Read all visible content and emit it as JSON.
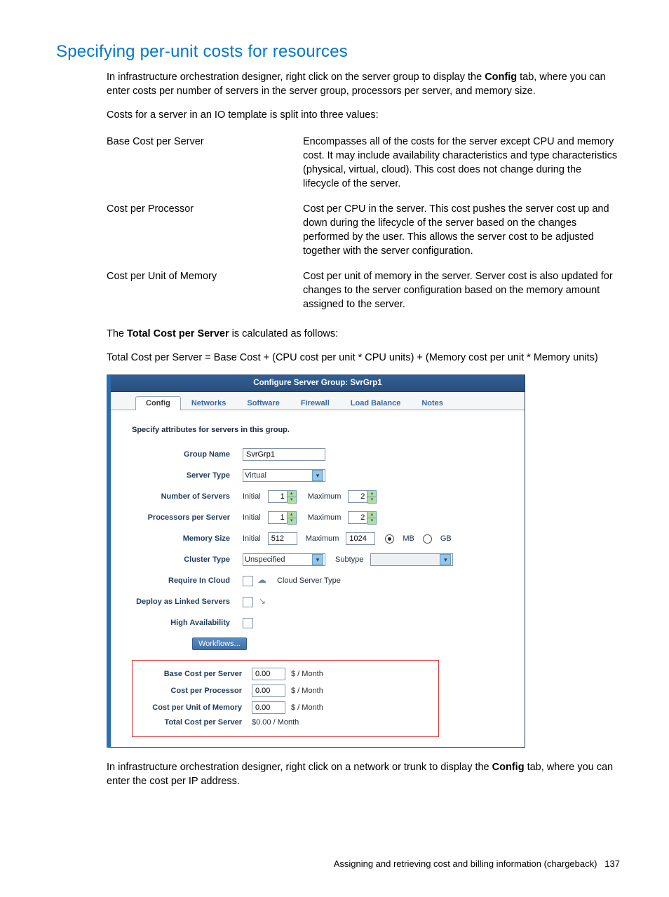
{
  "heading": "Specifying per-unit costs for resources",
  "p1_a": "In infrastructure orchestration designer, right click on the server group to display the ",
  "p1_b": "Config",
  "p1_c": " tab, where you can enter costs per number of servers in the server group, processors per server, and memory size.",
  "p2": "Costs for a server in an IO template is split into three values:",
  "defs": [
    {
      "term": "Base Cost per Server",
      "desc": "Encompasses all of the costs for the server except CPU and memory cost. It may include availability characteristics and type characteristics (physical, virtual, cloud). This cost does not change during the lifecycle of the server."
    },
    {
      "term": "Cost per Processor",
      "desc": "Cost per CPU in the server. This cost pushes the server cost up and down during the lifecycle of the server based on the changes performed by the user. This allows the server cost to be adjusted together with the server configuration."
    },
    {
      "term": "Cost per Unit of Memory",
      "desc": "Cost per unit of memory in the server. Server cost is also updated for changes to the server configuration based on the memory amount assigned to the server."
    }
  ],
  "p3_a": "The ",
  "p3_b": "Total Cost per Server",
  "p3_c": " is calculated as follows:",
  "formula": "Total Cost per Server = Base Cost + (CPU cost per unit * CPU units) + (Memory cost per unit * Memory units)",
  "dialog": {
    "title": "Configure Server Group: SvrGrp1",
    "tabs": [
      "Config",
      "Networks",
      "Software",
      "Firewall",
      "Load Balance",
      "Notes"
    ],
    "specify": "Specify attributes for servers in this group.",
    "group_name_label": "Group Name",
    "group_name": "SvrGrp1",
    "server_type_label": "Server Type",
    "server_type": "Virtual",
    "num_servers_label": "Number of Servers",
    "initial_label": "Initial",
    "maximum_label": "Maximum",
    "num_servers_initial": "1",
    "num_servers_max": "2",
    "proc_label": "Processors per Server",
    "proc_initial": "1",
    "proc_max": "2",
    "mem_label": "Memory Size",
    "mem_initial": "512",
    "mem_max": "1024",
    "mb": "MB",
    "gb": "GB",
    "cluster_label": "Cluster Type",
    "cluster_value": "Unspecified",
    "subtype_label": "Subtype",
    "subtype_value": "",
    "require_cloud_label": "Require In Cloud",
    "cloud_server_type": "Cloud Server Type",
    "deploy_linked_label": "Deploy as Linked Servers",
    "ha_label": "High Availability",
    "workflows": "Workflows...",
    "cost": {
      "base_label": "Base Cost per Server",
      "base_val": "0.00",
      "proc_label": "Cost per Processor",
      "proc_val": "0.00",
      "mem_label": "Cost per Unit of Memory",
      "mem_val": "0.00",
      "total_label": "Total Cost per Server",
      "total_val": "$0.00 / Month",
      "unit": "$ / Month"
    }
  },
  "p4_a": "In infrastructure orchestration designer, right click on a network or trunk to display the ",
  "p4_b": "Config",
  "p4_c": " tab, where you can enter the cost per IP address.",
  "footer_text": "Assigning and retrieving cost and billing information (chargeback)",
  "footer_page": "137"
}
